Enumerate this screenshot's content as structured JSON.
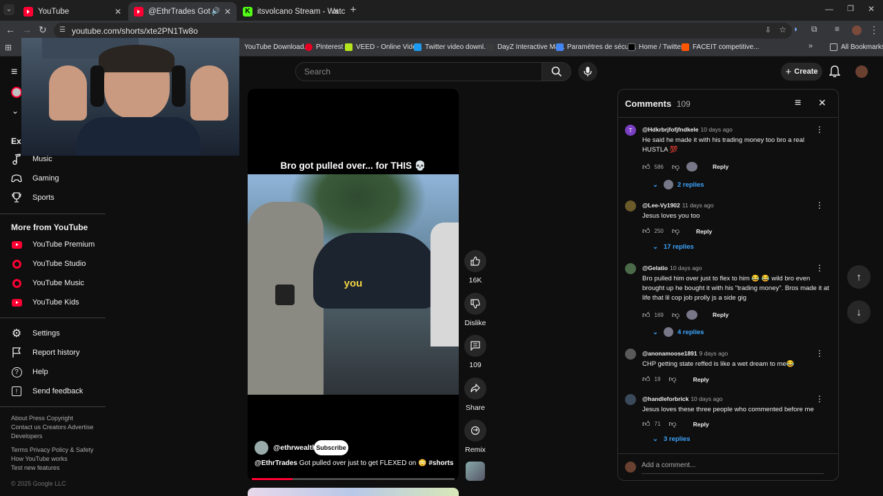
{
  "browser": {
    "tabs": [
      {
        "title": "YouTube"
      },
      {
        "title": "@EthrTrades Got pulled ove"
      },
      {
        "title": "itsvolcano Stream - Watch Live"
      }
    ],
    "url": "youtube.com/shorts/xte2PN1Tw8o",
    "bookmarks": [
      {
        "label": "YouTube Download..."
      },
      {
        "label": "Pinterest"
      },
      {
        "label": "VEED - Online Vide..."
      },
      {
        "label": "Twitter video downl..."
      },
      {
        "label": "DayZ Interactive Ma..."
      },
      {
        "label": "Paramètres de sécur..."
      },
      {
        "label": "Home / Twitter"
      },
      {
        "label": "FACEIT competitive..."
      }
    ],
    "all_bookmarks": "All Bookmarks"
  },
  "header": {
    "search_placeholder": "Search",
    "create_label": "Create"
  },
  "sidebar": {
    "explore_partial": "Exp",
    "explore_items": [
      {
        "label": "Music",
        "icon": "music-note-icon"
      },
      {
        "label": "Gaming",
        "icon": "gamepad-icon"
      },
      {
        "label": "Sports",
        "icon": "trophy-icon"
      }
    ],
    "more_title": "More from YouTube",
    "more_items": [
      {
        "label": "YouTube Premium"
      },
      {
        "label": "YouTube Studio"
      },
      {
        "label": "YouTube Music"
      },
      {
        "label": "YouTube Kids"
      }
    ],
    "settings_items": [
      {
        "label": "Settings",
        "icon": "gear-icon"
      },
      {
        "label": "Report history",
        "icon": "flag-icon"
      },
      {
        "label": "Help",
        "icon": "help-icon"
      },
      {
        "label": "Send feedback",
        "icon": "feedback-icon"
      }
    ],
    "footer1": "About  Press  Copyright",
    "footer2": "Contact us  Creators  Advertise",
    "footer3": "Developers",
    "footer4": "Terms  Privacy  Policy & Safety",
    "footer5": "How YouTube works",
    "footer6": "Test new features",
    "copyright": "© 2025 Google LLC"
  },
  "short": {
    "caption_top": "Bro got pulled over... for THIS 💀",
    "subtitle_word": "you",
    "channel": "@ethrwealth",
    "subscribe": "Subscribe",
    "title_handle": "@EthrTrades",
    "title_text": " Got pulled over just to get FLEXED on 😳 ",
    "hashtag": "#shorts",
    "progress": 0.2
  },
  "actions": {
    "likes": "16K",
    "dislike": "Dislike",
    "comments": "109",
    "share": "Share",
    "remix": "Remix"
  },
  "comments_panel": {
    "title": "Comments",
    "count": "109",
    "add_placeholder": "Add a comment...",
    "items": [
      {
        "user": "@Hdkrbrjfofjfndkele",
        "time": "10 days ago",
        "text": "He said he made it with his trading money too bro a real HUSTLA 💯",
        "likes": "586",
        "reply": "Reply",
        "replies": "2 replies",
        "avatar_letter": "T",
        "avatar_color": "#7b3fc4"
      },
      {
        "user": "@Lee-Vy1902",
        "time": "11 days ago",
        "text": "Jesus loves you too",
        "likes": "250",
        "reply": "Reply",
        "replies": "17 replies",
        "avatar_color": "#6b5a2a"
      },
      {
        "user": "@Gelatio",
        "time": "10 days ago",
        "text": "Bro pulled him over just to flex to him 😂 😂 wild bro even brought up he bought it with his \"trading money\". Bros made it at life that lil cop job prolly js a side gig",
        "likes": "169",
        "reply": "Reply",
        "replies": "4 replies",
        "avatar_color": "#4a6a4a"
      },
      {
        "user": "@anonamoose1891",
        "time": "9 days ago",
        "text": "CHP getting state reffed is like a wet dream to me😂",
        "likes": "19",
        "reply": "Reply",
        "avatar_color": "#5a5a5a"
      },
      {
        "user": "@handleforbrick",
        "time": "10 days ago",
        "text": "Jesus loves these three people who commented before me",
        "likes": "71",
        "reply": "Reply",
        "replies": "3 replies",
        "avatar_color": "#3a4a5a"
      }
    ]
  }
}
